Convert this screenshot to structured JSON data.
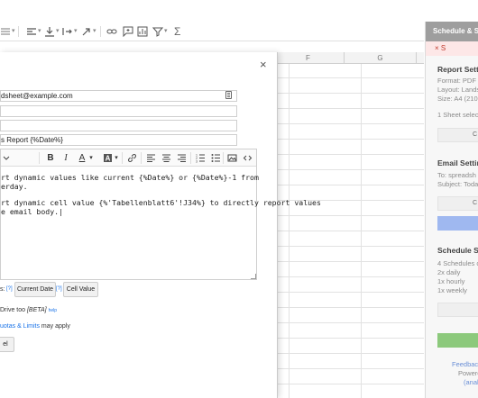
{
  "toolbar": {
    "icons": [
      "align-icon",
      "valign-icon",
      "wrap-icon",
      "rotate-icon",
      "link-icon",
      "comment-icon",
      "chart-icon",
      "filter-icon",
      "functions-icon"
    ],
    "sigma": "Σ"
  },
  "grid": {
    "columns": [
      "F",
      "G"
    ]
  },
  "dialog": {
    "close": "×",
    "recipients": "dsheet@example.com",
    "field2": "",
    "field3": "",
    "subject": "s Report {%Date%}",
    "editor_lines": [
      "rt dynamic values like current {%Date%} or {%Date%}-1 from",
      "erday.",
      "",
      "rt dynamic cell value {%'Tabellenblatt6'!J34%} to directly report values",
      "e email body."
    ],
    "insert_label": "s:",
    "help1": "[?]",
    "current_date_label": "Current Date",
    "help2": "[?]",
    "cell_value_label": "Cell Value",
    "drive_text": "Drive too ",
    "beta_text": "[BETA]",
    "help_link": "help",
    "quotas_link": "uotas & Limits",
    "quotas_tail": " may apply",
    "cancel_label": "el"
  },
  "sidebar": {
    "header": "Schedule & Se",
    "alert": "× S",
    "report_title": "Report Setti",
    "format": "Format: PDF",
    "layout": "Layout: Lands",
    "size": "Size: A4 (210",
    "sheets": "1 Sheet select",
    "btn1": "C",
    "email_title": "Email Settin",
    "to": "To: spreadsh",
    "subject": "Subject: Toda",
    "btn2": "C",
    "schedule_title": "Schedule S",
    "schedules": "4 Schedules c",
    "daily": "2x daily",
    "hourly": "1x hourly",
    "weekly": "1x weekly",
    "feedback": "Feedbac",
    "powered": "Powere",
    "anal": "(anal"
  }
}
